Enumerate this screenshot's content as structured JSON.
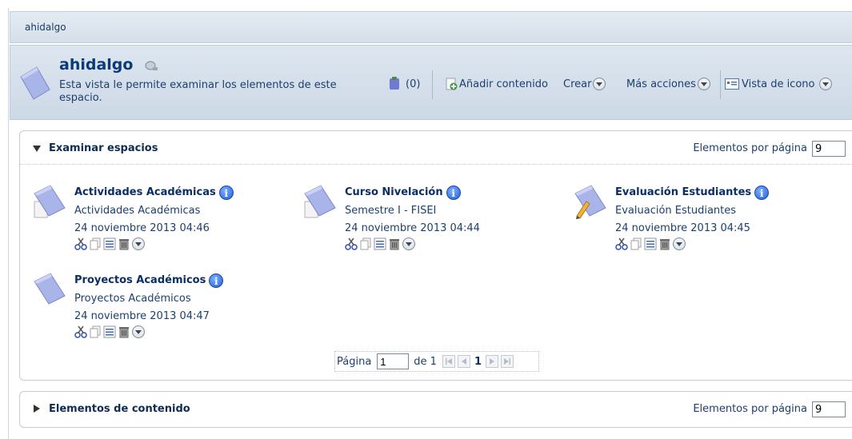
{
  "breadcrumb": {
    "label": "ahidalgo"
  },
  "header": {
    "title": "ahidalgo",
    "description": "Esta vista le permite examinar los elementos de este espacio.",
    "clipboard_count": "(0)",
    "add_content_label": "Añadir contenido",
    "create_label": "Crear",
    "more_actions_label": "Más acciones",
    "view_label": "Vista de icono"
  },
  "browse_spaces": {
    "title": "Examinar espacios",
    "items_per_page_label": "Elementos por página",
    "items_per_page_value": "9",
    "items": [
      {
        "name": "Actividades Académicas",
        "description": "Actividades Académicas",
        "date": "24 noviembre 2013 04:46",
        "icon": "space-folder-icon"
      },
      {
        "name": "Curso Nivelación",
        "description": "Semestre I - FISEI",
        "date": "24 noviembre 2013 04:44",
        "icon": "space-folder-icon"
      },
      {
        "name": "Evaluación Estudiantes",
        "description": "Evaluación Estudiantes",
        "date": "24 noviembre 2013 04:45",
        "icon": "space-pencil-icon"
      },
      {
        "name": "Proyectos Académicos",
        "description": "Proyectos Académicos",
        "date": "24 noviembre 2013 04:47",
        "icon": "space-folder-icon"
      }
    ],
    "pager": {
      "page_label": "Página",
      "page_value": "1",
      "of_label": "de 1",
      "current_page": "1"
    }
  },
  "content_items": {
    "title": "Elementos de contenido",
    "items_per_page_label": "Elementos por página",
    "items_per_page_value": "9"
  }
}
